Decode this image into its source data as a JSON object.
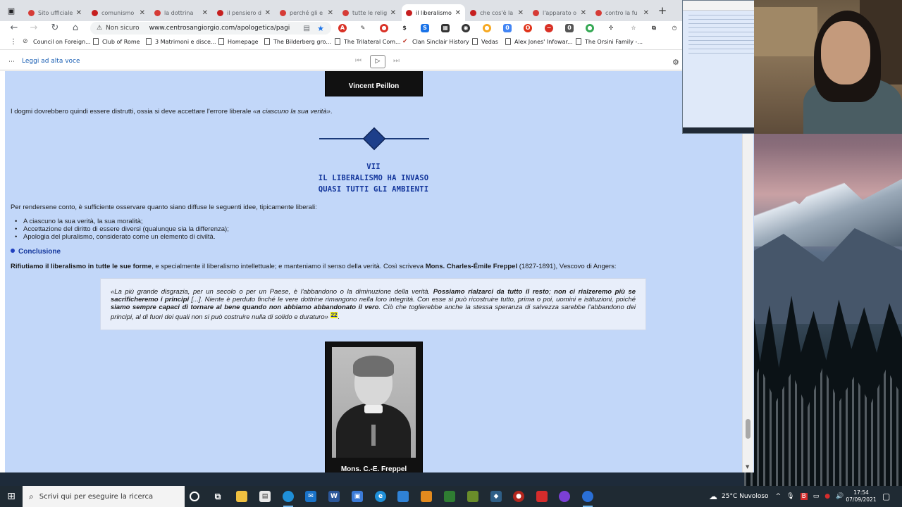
{
  "browser": {
    "tabs": [
      {
        "title": "Sito ufficiale",
        "active": false
      },
      {
        "title": "comunismo",
        "active": false
      },
      {
        "title": "la dottrina",
        "active": false
      },
      {
        "title": "il pensiero d",
        "active": false
      },
      {
        "title": "perché gli e",
        "active": false
      },
      {
        "title": "tutte le religi",
        "active": false
      },
      {
        "title": "il liberalismo",
        "active": true
      },
      {
        "title": "che cos'è la",
        "active": false
      },
      {
        "title": "l'apparato o",
        "active": false
      },
      {
        "title": "contro la fu",
        "active": false
      }
    ],
    "address": {
      "security_label": "Non sicuro",
      "url": "www.centrosangiorgio.com/apologetica/pagin..."
    },
    "extension_badges": {
      "icon_one": "0",
      "icon_two": "0"
    },
    "bookmarks": [
      "Council on Foreign...",
      "Club of Rome",
      "3 Matrimoni e disce...",
      "Homepage",
      "The Bilderberg gro...",
      "The Trilateral Com...",
      "Clan Sinclair History",
      "Vedas",
      "Alex Jones' Infowar...",
      "The Orsini Family -..."
    ],
    "read_aloud": {
      "label": "Leggi ad alta voce"
    }
  },
  "page": {
    "photo1_caption": "Vincent Peillon",
    "p1_before": "I dogmi dovrebbero quindi essere distrutti, ossia si deve accettare l'errore liberale ",
    "p1_quote": "«a ciascuno la sua verità»",
    "p1_after": ".",
    "heading": [
      "VII",
      "IL LIBERALISMO HA INVASO",
      "QUASI TUTTI GLI AMBIENTI"
    ],
    "p2": "Per rendersene conto, è sufficiente osservare quanto siano diffuse le seguenti idee, tipicamente liberali:",
    "list": [
      "A ciascuno la sua verità, la sua moralità;",
      "Accettazione del diritto di essere diversi (qualunque sia la differenza);",
      "Apologia del pluralismo, considerato come un elemento di civiltà."
    ],
    "conclusion_label": "Conclusione",
    "p3_bold": "Rifiutiamo il liberalismo in tutte le sue forme",
    "p3_mid": ", e specialmente il liberalismo intellettuale; e manteniamo il senso della verità. Così scriveva ",
    "p3_title": "Mons.",
    "p3_name": "Charles-Émile Freppel",
    "p3_end": " (1827-1891), Vescovo di Angers:",
    "quote": {
      "q1": "«La più grande disgrazia, per un secolo o per un Paese, è l'abbandono o la diminuzione della verità. ",
      "q2": "Possiamo rialzarci da tutto il resto",
      "q3": "; ",
      "q4": "non ci rialzeremo più se sacrificheremo i principi",
      "q5": " [...]. Niente è perduto finché le vere dottrine rimangono nella loro integrità. Con esse si può ricostruire tutto, prima o poi, uomini e istituzioni, poiché ",
      "q6": "siamo sempre capaci di tornare al bene quando non abbiamo abbandonato il vero",
      "q7": ". Ciò che toglierebbe anche la stessa speranza di salvezza sarebbe l'abbandono dei principi, al di fuori dei quali non si può costruire nulla di solido e duraturo»",
      "note": "22",
      "end": "."
    },
    "photo2_caption": "Mons. C.-E. Freppel"
  },
  "taskbar": {
    "search_placeholder": "Scrivi qui per eseguire la ricerca",
    "weather": "25°C  Nuvoloso",
    "time": "17:54",
    "date": "07/09/2021"
  },
  "colors": {
    "page_bg": "#c2d7f9",
    "heading": "#13369c",
    "note_highlight": "#f4f000",
    "taskbar": "#1f2a33"
  }
}
